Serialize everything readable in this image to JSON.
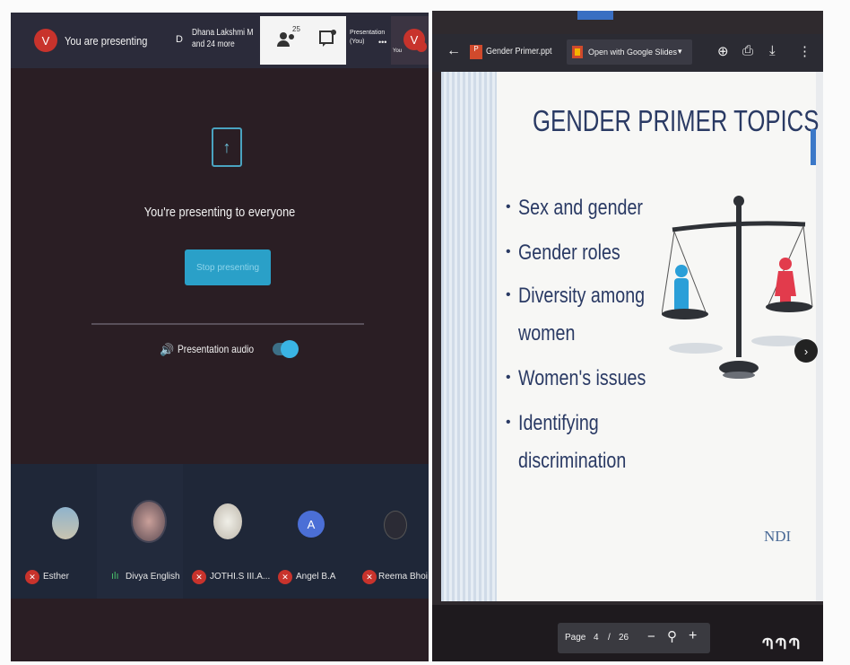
{
  "meet": {
    "presenting_avatar": "V",
    "presenting_label": "You are presenting",
    "participants_avatar": "D",
    "participants_line1": "Dhana Lakshmi M",
    "participants_line2": "and 24 more",
    "people_count": "25",
    "presentation_line1": "Presentation",
    "presentation_line2": "(You)",
    "you_label": "You",
    "self_avatar": "V",
    "presenting_message": "You're presenting to everyone",
    "stop_button": "Stop presenting",
    "audio_label": "Presentation audio",
    "participants": [
      {
        "name": "Esther",
        "mic": "off"
      },
      {
        "name": "Divya English",
        "mic": "on"
      },
      {
        "name": "JOTHI.S III.A...",
        "mic": "off"
      },
      {
        "name": "Angel B.A",
        "mic": "off",
        "initial": "A"
      },
      {
        "name": "Reema Bhoi",
        "mic": "off"
      }
    ]
  },
  "viewer": {
    "file_name": "Gender Primer.ppt",
    "open_with": "Open with Google Slides",
    "page_label": "Page",
    "page_current": "4",
    "page_sep": "/",
    "page_total": "26"
  },
  "slide": {
    "title": "GENDER PRIMER TOPICS",
    "bullets": [
      {
        "lines": [
          "Sex and gender"
        ]
      },
      {
        "lines": [
          "Gender roles"
        ]
      },
      {
        "lines": [
          "Diversity among",
          "women"
        ]
      },
      {
        "lines": [
          "Women's issues"
        ]
      },
      {
        "lines": [
          "Identifying",
          "discrimination"
        ]
      }
    ],
    "logo": "NDI"
  },
  "colors": {
    "meet_bg": "#2a1e24",
    "accent": "#2aa0c8",
    "mic_off": "#c8332c",
    "slide_title": "#2a3a64"
  }
}
